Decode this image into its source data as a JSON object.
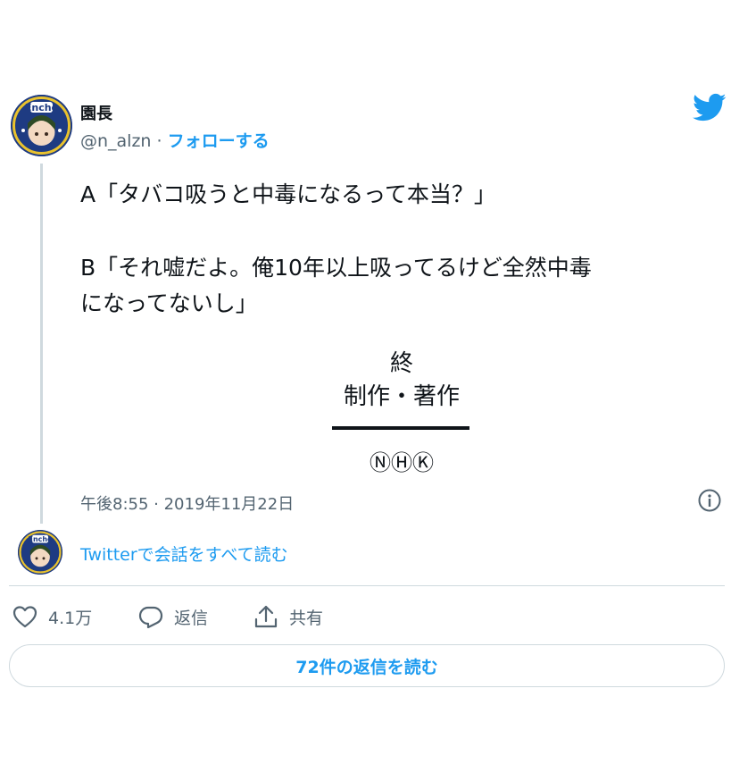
{
  "author": {
    "display_name": "園長",
    "handle": "@n_alzn",
    "separator": "·",
    "follow_label": "フォローする",
    "avatar_text": "Encho"
  },
  "tweet": {
    "line_a": "A「タバコ吸うと中毒になるって本当？」",
    "line_b1": "B「それ嘘だよ。俺10年以上吸ってるけど全然中毒",
    "line_b2": "になってないし」",
    "credit_end": "終",
    "credit_production": "制作・著作",
    "credit_logo": "ⓃⒽⓀ"
  },
  "meta": {
    "timestamp": "午後8:55 · 2019年11月22日"
  },
  "conversation_link": "Twitterで会話をすべて読む",
  "actions": {
    "like_count": "4.1万",
    "reply_label": "返信",
    "share_label": "共有"
  },
  "replies_button": "72件の返信を読む",
  "colors": {
    "accent": "#1d9bf0",
    "secondary_text": "#536471",
    "border": "#cfd9de"
  },
  "icons": [
    "twitter-bird-icon",
    "info-icon",
    "heart-icon",
    "reply-icon",
    "share-icon"
  ]
}
